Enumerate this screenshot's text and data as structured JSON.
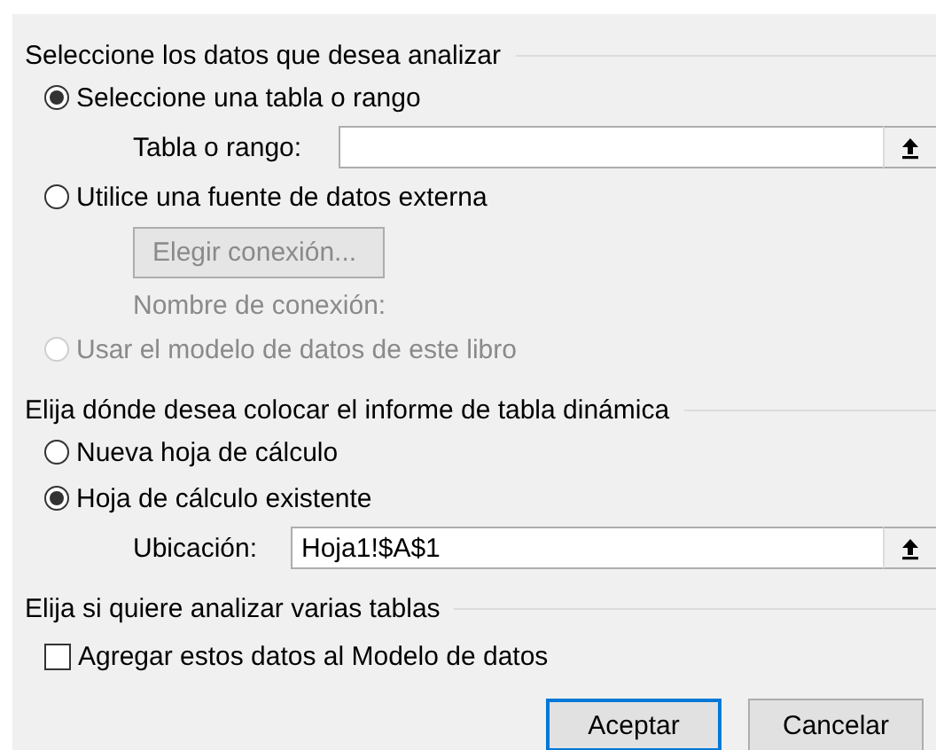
{
  "sections": [
    {
      "title": "Seleccione los datos que desea analizar",
      "items": [
        {
          "kind": "radio",
          "label": "Seleccione una tabla o rango",
          "selected": true,
          "disabled": false
        },
        {
          "kind": "field",
          "label": "Tabla o rango:",
          "value": ""
        },
        {
          "kind": "radio",
          "label": "Utilice una fuente de datos externa",
          "selected": false,
          "disabled": false
        },
        {
          "kind": "button",
          "label": "Elegir conexión...",
          "disabled": true
        },
        {
          "kind": "caption",
          "label": "Nombre de conexión:",
          "disabled": true
        },
        {
          "kind": "radio",
          "label": "Usar el modelo de datos de este libro",
          "selected": false,
          "disabled": true
        }
      ]
    },
    {
      "title": "Elija dónde desea colocar el informe de tabla dinámica",
      "items": [
        {
          "kind": "radio",
          "label": "Nueva hoja de cálculo",
          "selected": false,
          "disabled": false
        },
        {
          "kind": "radio",
          "label": "Hoja de cálculo existente",
          "selected": true,
          "disabled": false
        },
        {
          "kind": "field",
          "label": "Ubicación:",
          "value": "Hoja1!$A$1"
        }
      ]
    },
    {
      "title": "Elija si quiere analizar varias tablas",
      "items": [
        {
          "kind": "checkbox",
          "label": "Agregar estos datos al Modelo de datos",
          "checked": false,
          "disabled": false
        }
      ]
    }
  ],
  "buttons": [
    {
      "label": "Aceptar",
      "default": true
    },
    {
      "label": "Cancelar",
      "default": false
    }
  ]
}
